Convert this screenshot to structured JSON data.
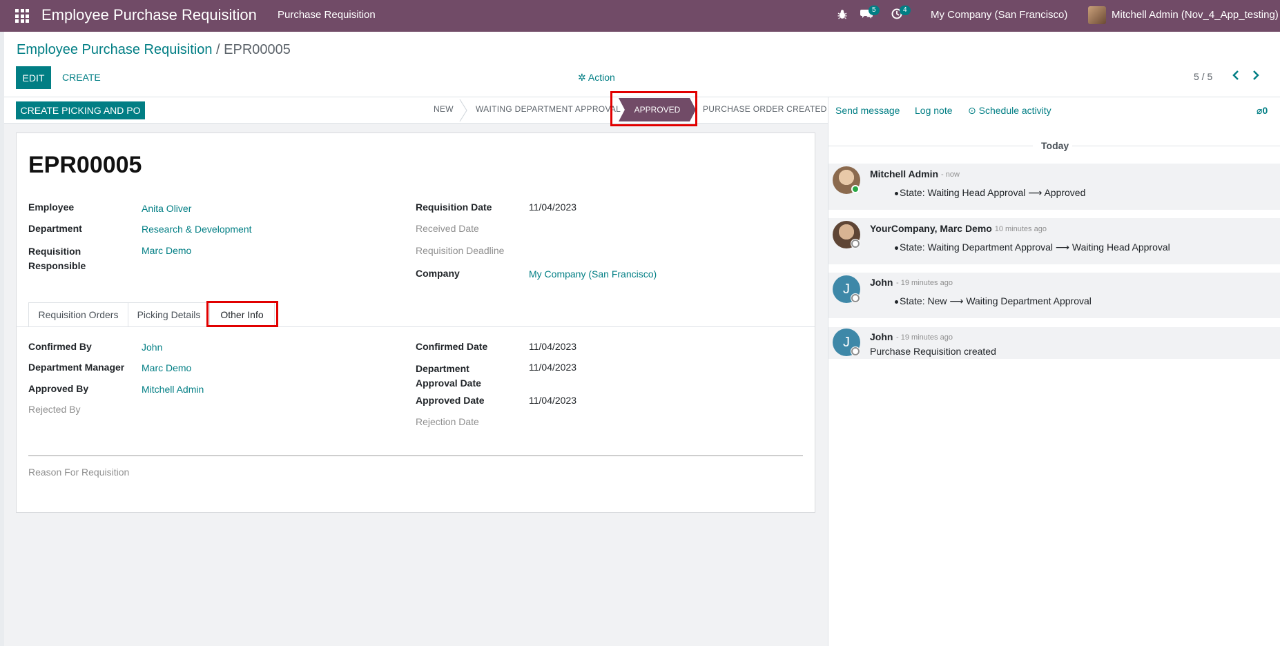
{
  "navbar": {
    "app_title": "Employee Purchase Requisition",
    "menu_item": "Purchase Requisition",
    "chat_badge": "5",
    "activity_badge": "4",
    "company": "My Company (San Francisco)",
    "user": "Mitchell Admin (Nov_4_App_testing)",
    "bg_color": "#714b67"
  },
  "breadcrumb": {
    "parent": "Employee Purchase Requisition",
    "separator": " / ",
    "current": "EPR00005"
  },
  "control": {
    "edit_label": "EDIT",
    "create_label": "CREATE",
    "action_label": "Action",
    "pager": "5 / 5"
  },
  "statusbar": {
    "button_label": "CREATE PICKING AND PO",
    "stages": [
      "NEW",
      "WAITING DEPARTMENT APPROVAL",
      "APPROVED",
      "PURCHASE ORDER CREATED"
    ],
    "active_stage": "APPROVED"
  },
  "form": {
    "title": "EPR00005",
    "left_fields": [
      {
        "label": "Employee",
        "value": "Anita Oliver"
      },
      {
        "label": "Department",
        "value": "Research & Development"
      },
      {
        "label": "Requisition Responsible",
        "value": "Marc Demo"
      }
    ],
    "right_fields": [
      {
        "label": "Requisition Date",
        "value": "11/04/2023"
      },
      {
        "label": "Received Date",
        "value": ""
      },
      {
        "label": "Requisition Deadline",
        "value": ""
      },
      {
        "label": "Company",
        "value": "My Company (San Francisco)"
      }
    ],
    "tabs": [
      "Requisition Orders",
      "Picking Details",
      "Other Info"
    ],
    "active_tab": "Other Info",
    "other_info_left": [
      {
        "label": "Confirmed By",
        "value": "John"
      },
      {
        "label": "Department Manager",
        "value": "Marc Demo"
      },
      {
        "label": "Approved By",
        "value": "Mitchell Admin"
      },
      {
        "label": "Rejected By",
        "value": ""
      }
    ],
    "other_info_right": [
      {
        "label": "Confirmed Date",
        "value": "11/04/2023"
      },
      {
        "label": "Department Approval Date",
        "value": "11/04/2023"
      },
      {
        "label": "Approved Date",
        "value": "11/04/2023"
      },
      {
        "label": "Rejection Date",
        "value": ""
      }
    ],
    "reason_label": "Reason For Requisition"
  },
  "chatter": {
    "send_message": "Send message",
    "log_note": "Log note",
    "schedule_activity": "Schedule activity",
    "attachments_count": "0",
    "date_separator": "Today",
    "messages": [
      {
        "author": "Mitchell Admin",
        "time": "- now",
        "body": "State: Waiting Head Approval ⟶ Approved",
        "avatar": "photo"
      },
      {
        "author": "YourCompany, Marc Demo",
        "time": "- 10 minutes ago",
        "body": "State: Waiting Department Approval ⟶ Waiting Head Approval",
        "avatar": "photo"
      },
      {
        "author": "John",
        "time": "- 19 minutes ago",
        "body": "State: New ⟶ Waiting Department Approval",
        "avatar": "J"
      },
      {
        "author": "John",
        "time": "- 19 minutes ago",
        "body": "Purchase Requisition created",
        "avatar": "J"
      }
    ]
  },
  "colors": {
    "primary": "#714b67",
    "accent": "#017e84",
    "highlight": "#e10000"
  }
}
